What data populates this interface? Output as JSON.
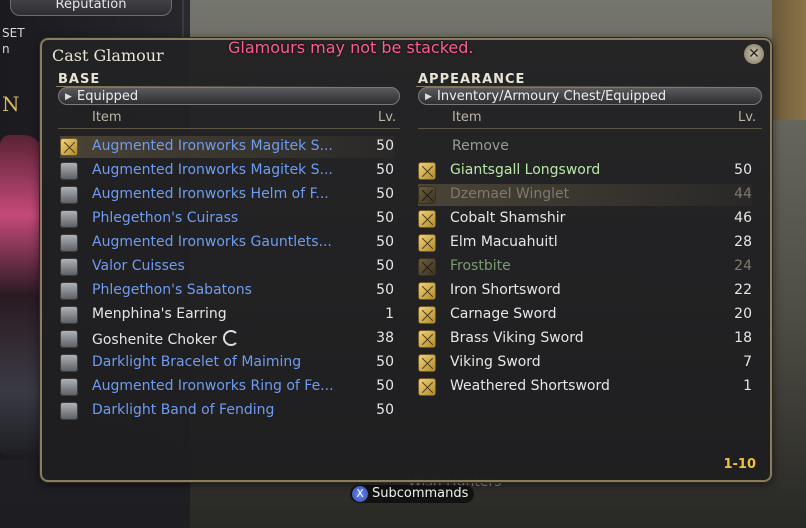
{
  "background": {
    "reputation_tab": "Reputation",
    "side_text_1": "SET",
    "side_text_2": "n",
    "side_big": "N",
    "sign_text": "Wish Hunters"
  },
  "window": {
    "title": "Cast Glamour",
    "notice": "Glamours may not be stacked.",
    "notice_color": "#ff5f8f",
    "close_icon": "close-icon",
    "pager": "1-10"
  },
  "base": {
    "label": "BASE",
    "dropdown": "Equipped",
    "col_item": "Item",
    "col_lv": "Lv.",
    "items": [
      {
        "name": "Augmented Ironworks Magitek S...",
        "lv": "50",
        "color": "blue",
        "icon": "weapon-icon",
        "icon_style": "sword",
        "selected": true
      },
      {
        "name": "Augmented Ironworks Magitek S...",
        "lv": "50",
        "color": "blue",
        "icon": "shield-icon",
        "icon_style": "gear"
      },
      {
        "name": "Augmented Ironworks Helm of F...",
        "lv": "50",
        "color": "blue",
        "icon": "helm-icon",
        "icon_style": "gear"
      },
      {
        "name": "Phlegethon's Cuirass",
        "lv": "50",
        "color": "blue",
        "icon": "body-armor-icon",
        "icon_style": "gear"
      },
      {
        "name": "Augmented Ironworks Gauntlets...",
        "lv": "50",
        "color": "blue",
        "icon": "gauntlets-icon",
        "icon_style": "gear"
      },
      {
        "name": "Valor Cuisses",
        "lv": "50",
        "color": "blue",
        "icon": "legs-icon",
        "icon_style": "gear"
      },
      {
        "name": "Phlegethon's Sabatons",
        "lv": "50",
        "color": "blue",
        "icon": "feet-icon",
        "icon_style": "gear"
      },
      {
        "name": "Menphina's Earring",
        "lv": "1",
        "color": "white",
        "icon": "earring-icon",
        "icon_style": "gear"
      },
      {
        "name": "Goshenite Choker",
        "lv": "38",
        "color": "white",
        "icon": "necklace-icon",
        "icon_style": "gear",
        "extra_icon": true
      },
      {
        "name": "Darklight Bracelet of Maiming",
        "lv": "50",
        "color": "blue",
        "icon": "bracelet-icon",
        "icon_style": "gear"
      },
      {
        "name": "Augmented Ironworks Ring of Fe...",
        "lv": "50",
        "color": "blue",
        "icon": "ring-icon",
        "icon_style": "gear"
      },
      {
        "name": "Darklight Band of Fending",
        "lv": "50",
        "color": "blue",
        "icon": "ring-icon",
        "icon_style": "gear"
      }
    ]
  },
  "appearance": {
    "label": "APPEARANCE",
    "dropdown": "Inventory/Armoury Chest/Equipped",
    "col_item": "Item",
    "col_lv": "Lv.",
    "remove_label": "Remove",
    "items": [
      {
        "name": "Giantsgall Longsword",
        "lv": "50",
        "color": "green",
        "dim": false
      },
      {
        "name": "Dzemael Winglet",
        "lv": "44",
        "color": "dim",
        "dim": true,
        "selected": true
      },
      {
        "name": "Cobalt Shamshir",
        "lv": "46",
        "color": "white",
        "dim": false
      },
      {
        "name": "Elm Macuahuitl",
        "lv": "28",
        "color": "white",
        "dim": false
      },
      {
        "name": "Frostbite",
        "lv": "24",
        "color": "dimgreen",
        "dim": true
      },
      {
        "name": "Iron Shortsword",
        "lv": "22",
        "color": "white",
        "dim": false
      },
      {
        "name": "Carnage Sword",
        "lv": "20",
        "color": "white",
        "dim": false
      },
      {
        "name": "Brass Viking Sword",
        "lv": "18",
        "color": "white",
        "dim": false
      },
      {
        "name": "Viking Sword",
        "lv": "7",
        "color": "white",
        "dim": false
      },
      {
        "name": "Weathered Shortsword",
        "lv": "1",
        "color": "white",
        "dim": false
      }
    ]
  },
  "footer": {
    "button_icon": "X",
    "subcommands": "Subcommands"
  }
}
